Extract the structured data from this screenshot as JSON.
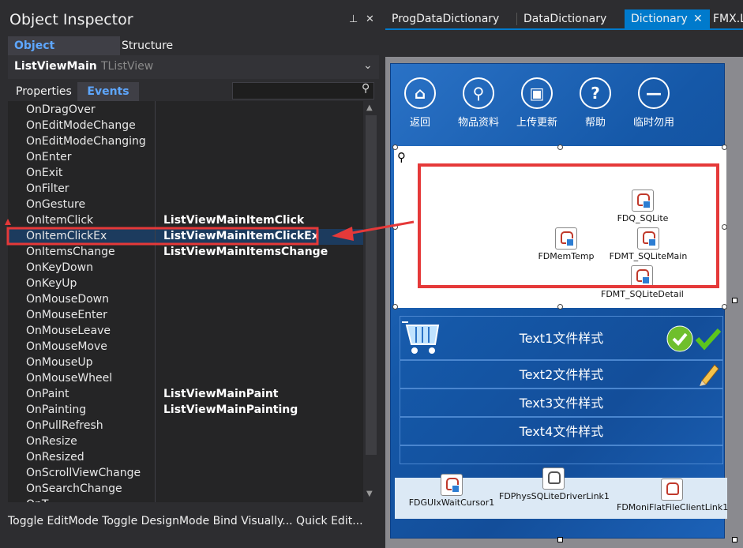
{
  "window_title": "Object Inspector",
  "panel_tabs": [
    {
      "label": "Object Inspector"
    },
    {
      "label": "Structure"
    }
  ],
  "component": {
    "name": "ListViewMain",
    "type": "TListView"
  },
  "sub_tabs": [
    {
      "label": "Properties"
    },
    {
      "label": "Events"
    }
  ],
  "events": [
    {
      "name": "OnDragOver",
      "value": ""
    },
    {
      "name": "OnEditModeChange",
      "value": ""
    },
    {
      "name": "OnEditModeChanging",
      "value": ""
    },
    {
      "name": "OnEnter",
      "value": ""
    },
    {
      "name": "OnExit",
      "value": ""
    },
    {
      "name": "OnFilter",
      "value": ""
    },
    {
      "name": "OnGesture",
      "value": ""
    },
    {
      "name": "OnItemClick",
      "value": "ListViewMainItemClick"
    },
    {
      "name": "OnItemClickEx",
      "value": "ListViewMainItemClickEx"
    },
    {
      "name": "OnItemsChange",
      "value": "ListViewMainItemsChange"
    },
    {
      "name": "OnKeyDown",
      "value": ""
    },
    {
      "name": "OnKeyUp",
      "value": ""
    },
    {
      "name": "OnMouseDown",
      "value": ""
    },
    {
      "name": "OnMouseEnter",
      "value": ""
    },
    {
      "name": "OnMouseLeave",
      "value": ""
    },
    {
      "name": "OnMouseMove",
      "value": ""
    },
    {
      "name": "OnMouseUp",
      "value": ""
    },
    {
      "name": "OnMouseWheel",
      "value": ""
    },
    {
      "name": "OnPaint",
      "value": "ListViewMainPaint"
    },
    {
      "name": "OnPainting",
      "value": "ListViewMainPainting"
    },
    {
      "name": "OnPullRefresh",
      "value": ""
    },
    {
      "name": "OnResize",
      "value": ""
    },
    {
      "name": "OnResized",
      "value": ""
    },
    {
      "name": "OnScrollViewChange",
      "value": ""
    },
    {
      "name": "OnSearchChange",
      "value": ""
    },
    {
      "name": "OnT...",
      "value": ""
    }
  ],
  "selected_event_index": 8,
  "status_text": "Toggle EditMode Toggle DesignMode Bind Visually... Quick Edit...",
  "doc_tabs": [
    {
      "label": "ProgDataDictionary"
    },
    {
      "label": "DataDictionary"
    },
    {
      "label": "Dictionary"
    },
    {
      "label": "FMX.L"
    }
  ],
  "active_doc_tab": 2,
  "toolbar_buttons": [
    {
      "label": "返回",
      "icon": "home-icon",
      "glyph": "⌂"
    },
    {
      "label": "物品资料",
      "icon": "search-icon",
      "glyph": "⚲"
    },
    {
      "label": "上传更新",
      "icon": "save-icon",
      "glyph": "▣"
    },
    {
      "label": "帮助",
      "icon": "help-icon",
      "glyph": "?"
    },
    {
      "label": "临时勿用",
      "icon": "minus-icon",
      "glyph": "—"
    }
  ],
  "data_components": [
    {
      "label": "FDQ_SQLite"
    },
    {
      "label": "FDMemTemp"
    },
    {
      "label": "FDMT_SQLiteMain"
    },
    {
      "label": "FDMT_SQLiteDetail"
    }
  ],
  "list_items": [
    {
      "label": "Text1文件样式"
    },
    {
      "label": "Text2文件样式"
    },
    {
      "label": "Text3文件样式"
    },
    {
      "label": "Text4文件样式"
    }
  ],
  "tray_components": [
    {
      "label": "FDGUIxWaitCursor1"
    },
    {
      "label": "FDPhysSQLiteDriverLink1"
    },
    {
      "label": "FDMoniFlatFileClientLink1"
    }
  ],
  "colors": {
    "accent": "#5ea7ff",
    "highlight": "#e53939",
    "form_blue": "#1558a8"
  }
}
